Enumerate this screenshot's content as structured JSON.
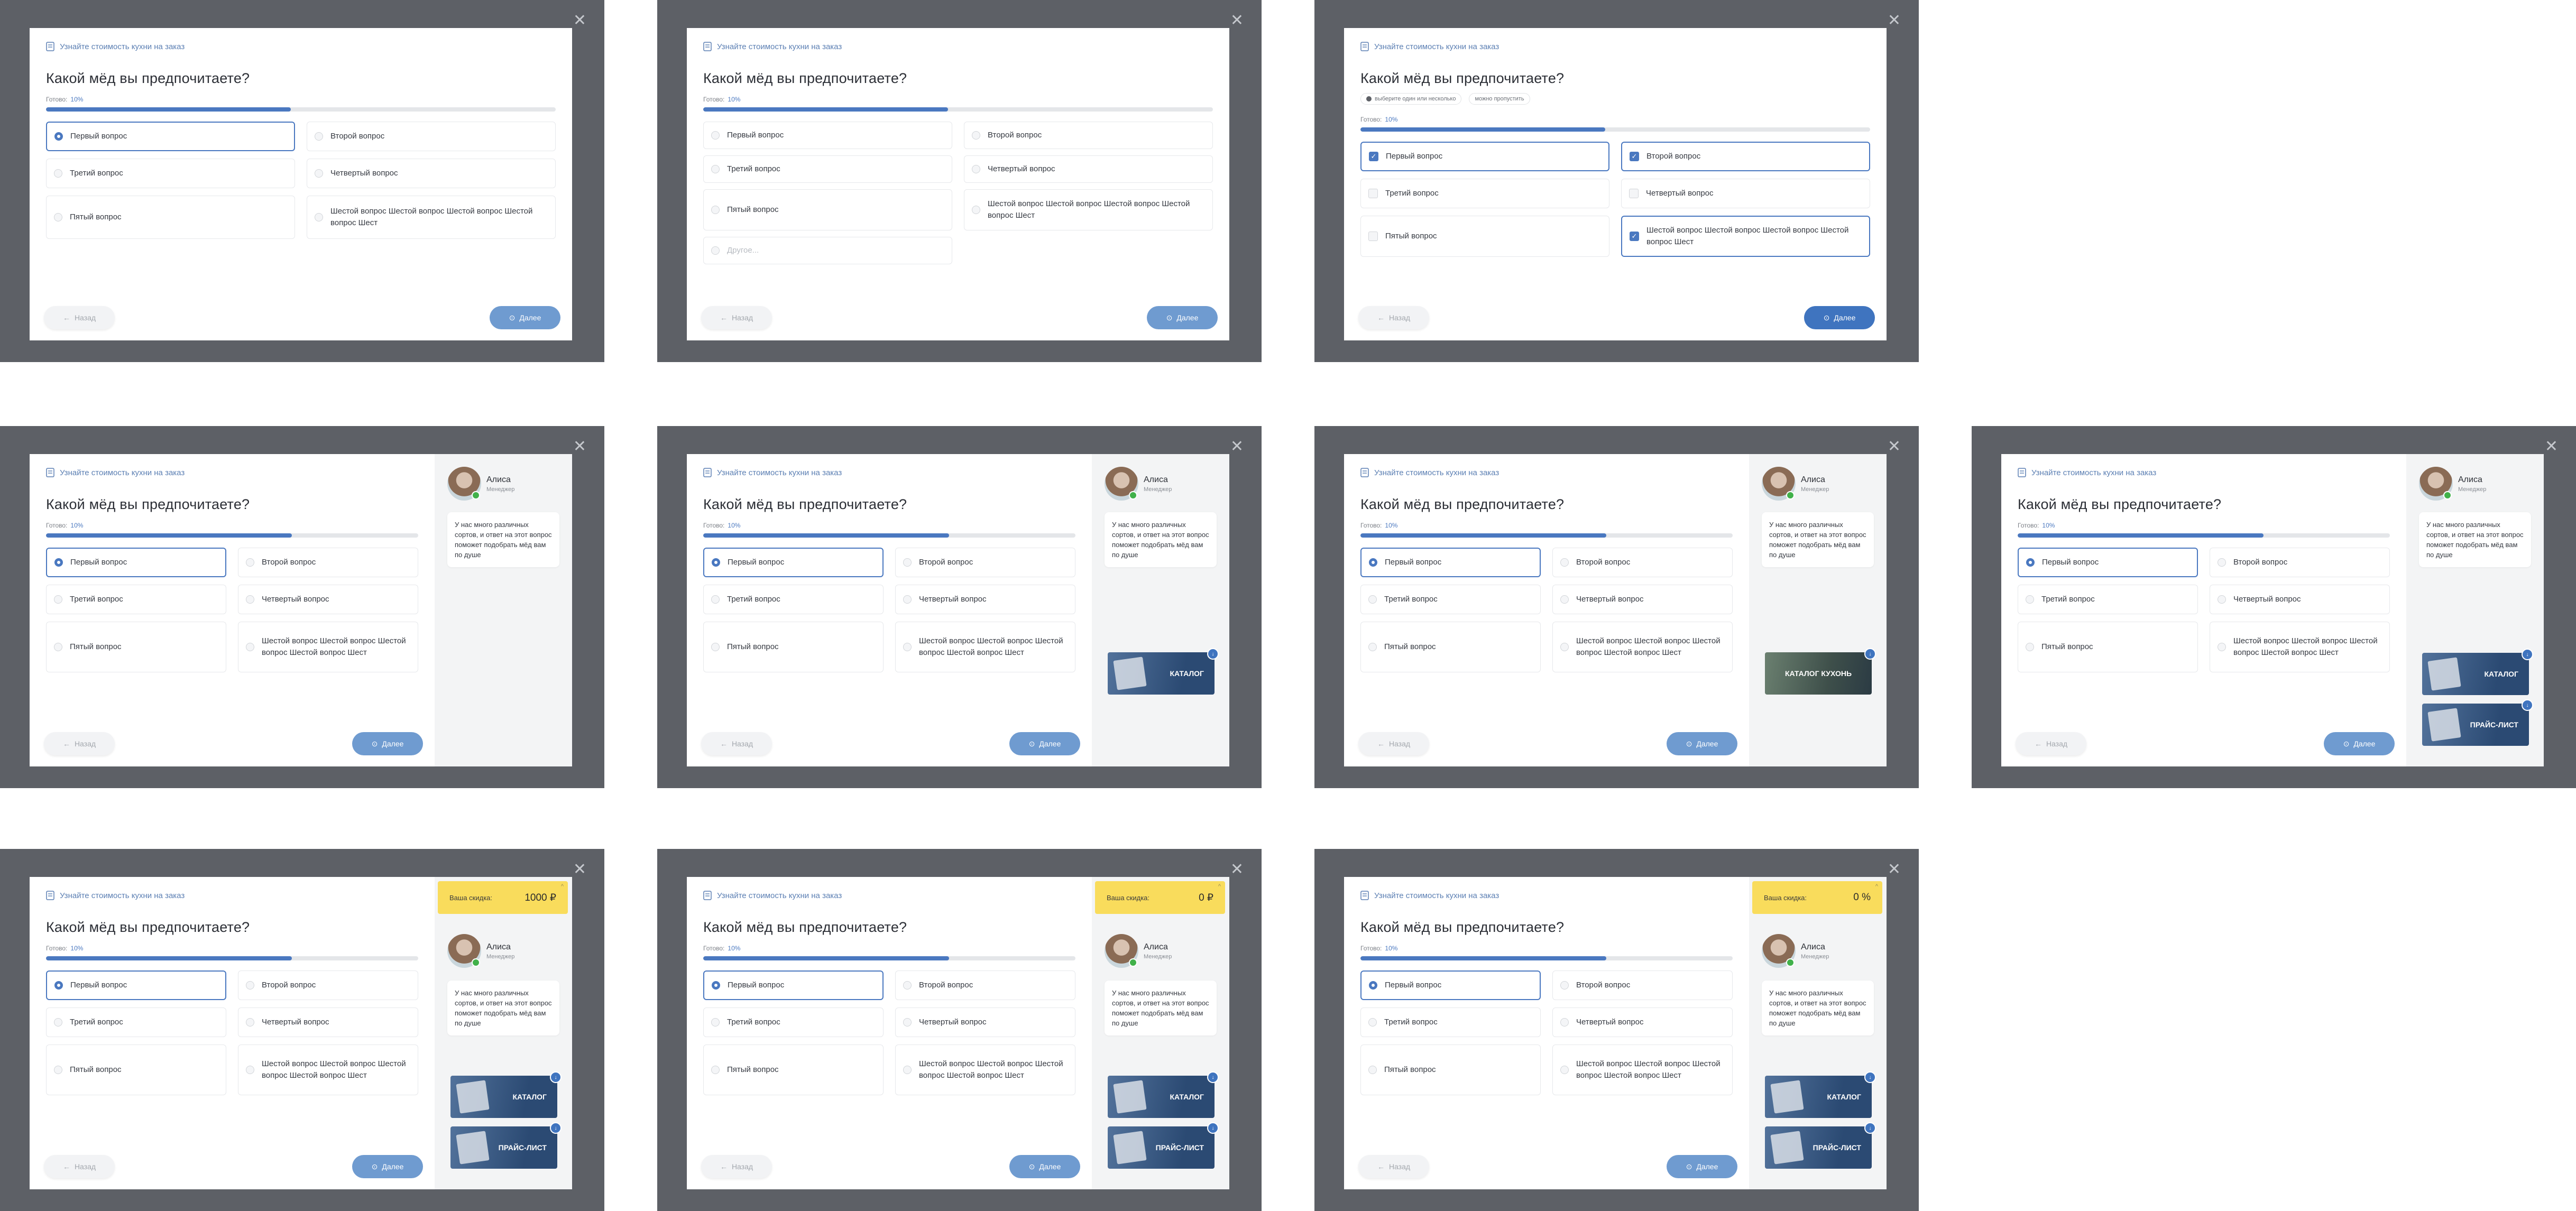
{
  "common": {
    "header": "Узнайте стоимость кухни на заказ",
    "question": "Какой мёд вы предпочитаете?",
    "progress_label": "Готово:",
    "progress_value": "10%",
    "progress_fraction": 0.1,
    "back": "Назад",
    "next": "Далее",
    "close_icon": "✕",
    "options": [
      "Первый вопрос",
      "Второй вопрос",
      "Третий вопрос",
      "Четвертый вопрос",
      "Пятый вопрос",
      "Шестой вопрос Шестой вопрос Шестой вопрос Шестой вопрос Шест"
    ],
    "other_placeholder": "Другое...",
    "hint_multi": "выберите один или несколько",
    "hint_skip": "можно пропустить",
    "manager_name": "Алиса",
    "manager_role": "Менеджер",
    "manager_message": "У нас много различных сортов, и ответ на этот вопрос поможет подобрать мёд вам по душе",
    "promo_catalog": "КАТАЛОГ",
    "promo_catalog_kitchens": "КАТАЛОГ КУХОНЬ",
    "promo_price": "ПРАЙС-ЛИСТ",
    "discount_label": "Ваша скидка:",
    "discounts": [
      "1000 ₽",
      "0 ₽",
      "0 %"
    ]
  },
  "colors": {
    "accent": "#4a78c0",
    "overlay": "#5d6066",
    "discount": "#f9dc5c"
  }
}
